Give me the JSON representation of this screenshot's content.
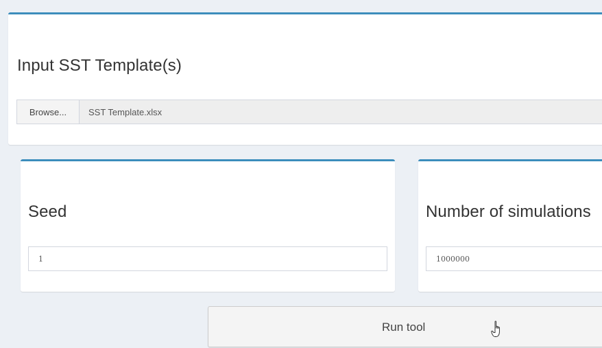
{
  "template_panel": {
    "label": "Input SST Template(s)",
    "browse_label": "Browse...",
    "file_name": "SST Template.xlsx"
  },
  "seed_panel": {
    "label": "Seed",
    "value": "1"
  },
  "simulations_panel": {
    "label": "Number of simulations",
    "value": "1000000"
  },
  "run_button": {
    "label": "Run tool"
  },
  "icons": {
    "pointer": "hand-pointer-icon"
  },
  "colors": {
    "accent": "#3c8dbc",
    "background": "#ecf0f5",
    "panel": "#ffffff"
  }
}
